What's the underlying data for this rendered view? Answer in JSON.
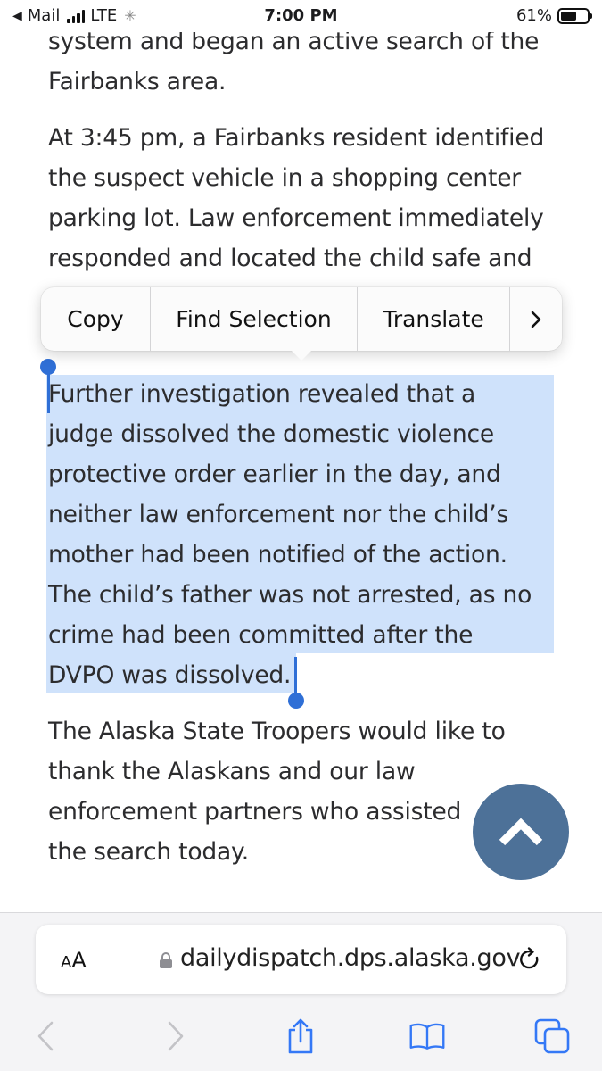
{
  "status_bar": {
    "carrier": "Mail",
    "network": "LTE",
    "time": "7:00 PM",
    "battery": "61%",
    "battery_level": 0.61
  },
  "article": {
    "p1_line1": "system and began an active search of the",
    "p1_line2": "Fairbanks area.",
    "p2_lines": [
      "At 3:45 pm, a Fairbanks resident identified",
      "the suspect vehicle in a shopping center",
      "parking lot. Law enforcement immediately",
      "responded and located the child safe and"
    ],
    "p3_lines": [
      "Further investigation revealed that a",
      "judge dissolved the domestic violence",
      "protective order earlier in the day, and",
      "neither law enforcement nor the child’s",
      "mother had been notified of the action.",
      "The child’s father was not arrested, as no",
      "crime had been committed after the",
      "DVPO was dissolved."
    ],
    "p4_lines": [
      "The Alaska State Troopers would like to",
      "thank the Alaskans and our law",
      "enforcement partners who assisted",
      "the search today."
    ]
  },
  "context_menu": {
    "copy": "Copy",
    "find_selection": "Find Selection",
    "translate": "Translate",
    "more": "›"
  },
  "url_bar": {
    "aa_label_small": "A",
    "aa_label_large": "A",
    "url": "dailydispatch.dps.alaska.gov"
  },
  "colors": {
    "selection": "#cfe2fb",
    "selection_handle": "#2f6fd6",
    "scroll_button": "#4d7198",
    "toolbar_icon": "#3478f6"
  }
}
